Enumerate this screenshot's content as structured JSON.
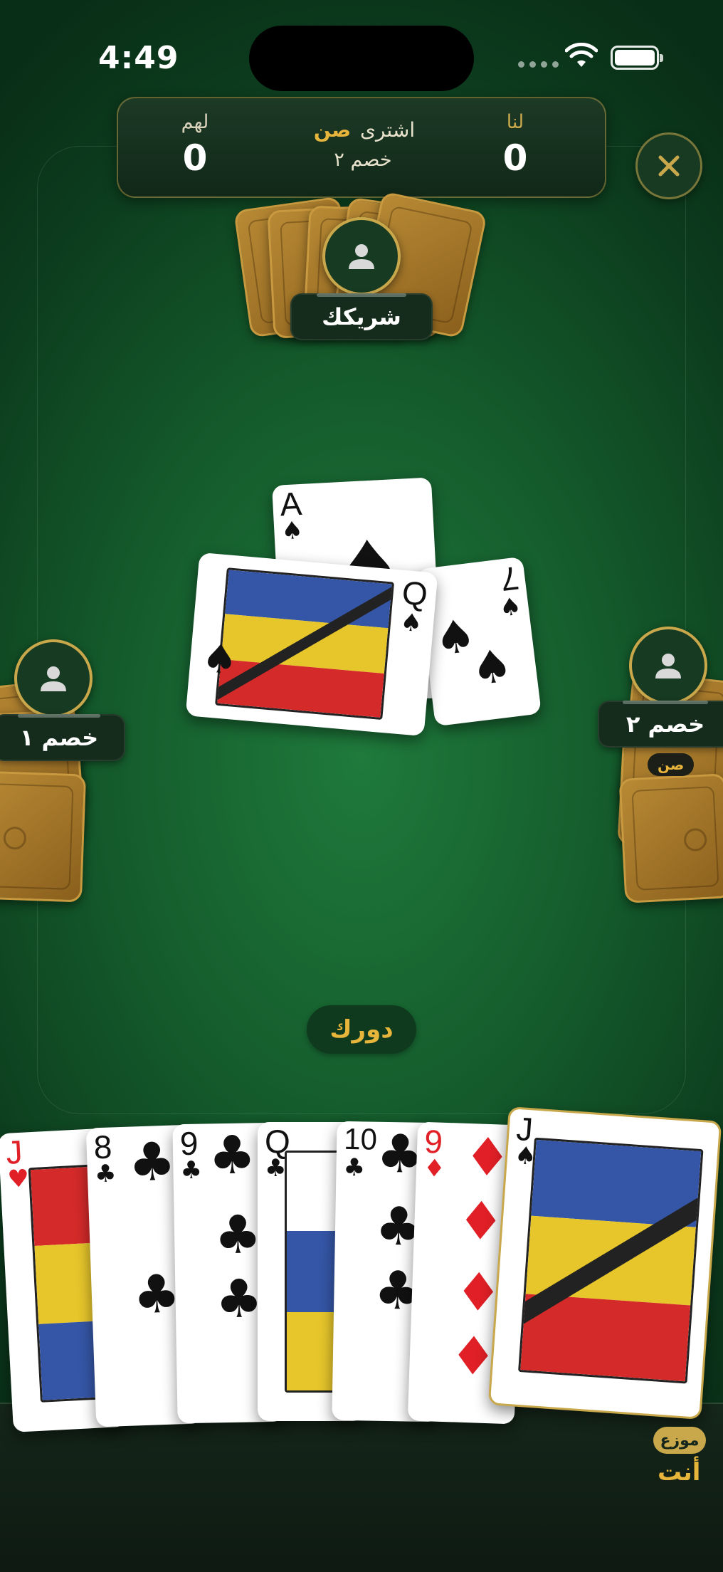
{
  "status_bar": {
    "time": "4:49"
  },
  "scoreboard": {
    "us_label": "لنا",
    "us_score": "0",
    "them_label": "لهم",
    "them_score": "0",
    "contract_prefix": "اشترى",
    "contract_type": "صن",
    "contract_buyer": "خصم ٢"
  },
  "players": {
    "partner": {
      "name": "شريكك"
    },
    "left": {
      "name": "خصم ١"
    },
    "right": {
      "name": "خصم ٢",
      "chip": "صن"
    },
    "you": {
      "name": "أنت",
      "dealer_chip": "موزع"
    }
  },
  "turn_indicator": "دورك",
  "trick": [
    {
      "rank": "A",
      "suit": "♠",
      "color": "black"
    },
    {
      "rank": "7",
      "suit": "♠",
      "color": "black"
    },
    {
      "rank": "Q",
      "suit": "♠",
      "color": "black"
    }
  ],
  "hand": [
    {
      "rank": "J",
      "suit": "♥",
      "color": "red"
    },
    {
      "rank": "8",
      "suit": "♣",
      "color": "black"
    },
    {
      "rank": "9",
      "suit": "♣",
      "color": "black"
    },
    {
      "rank": "Q",
      "suit": "♣",
      "color": "black"
    },
    {
      "rank": "10",
      "suit": "♣",
      "color": "black"
    },
    {
      "rank": "9",
      "suit": "♦",
      "color": "red"
    },
    {
      "rank": "J",
      "suit": "♠",
      "color": "black"
    }
  ],
  "colors": {
    "felt": "#145a2b",
    "gold": "#c9a84c",
    "accent": "#e7b53b",
    "red_suit": "#e01f26"
  }
}
